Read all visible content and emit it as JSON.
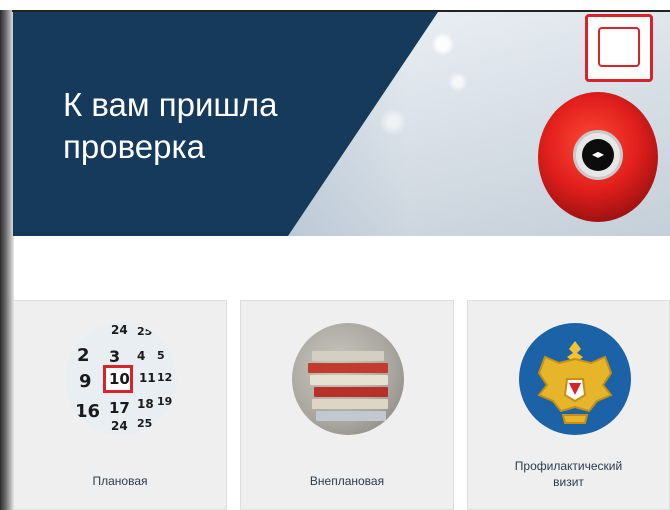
{
  "hero": {
    "title": "К вам пришла\nпроверка"
  },
  "cards": [
    {
      "label": "Плановая",
      "icon": "calendar-icon"
    },
    {
      "label": "Внеплановая",
      "icon": "folders-icon"
    },
    {
      "label": "Профилактический\nвизит",
      "icon": "emchs-emblem-icon"
    }
  ],
  "calendar_numbers": [
    "24",
    "25",
    "2",
    "3",
    "4",
    "5",
    "9",
    "10",
    "11",
    "12",
    "16",
    "17",
    "18",
    "19",
    "24",
    "25"
  ],
  "colors": {
    "hero_panel": "#153a5c",
    "card_bg": "#efefef",
    "accent_red": "#d8232a",
    "emblem_blue": "#1b63a6"
  }
}
